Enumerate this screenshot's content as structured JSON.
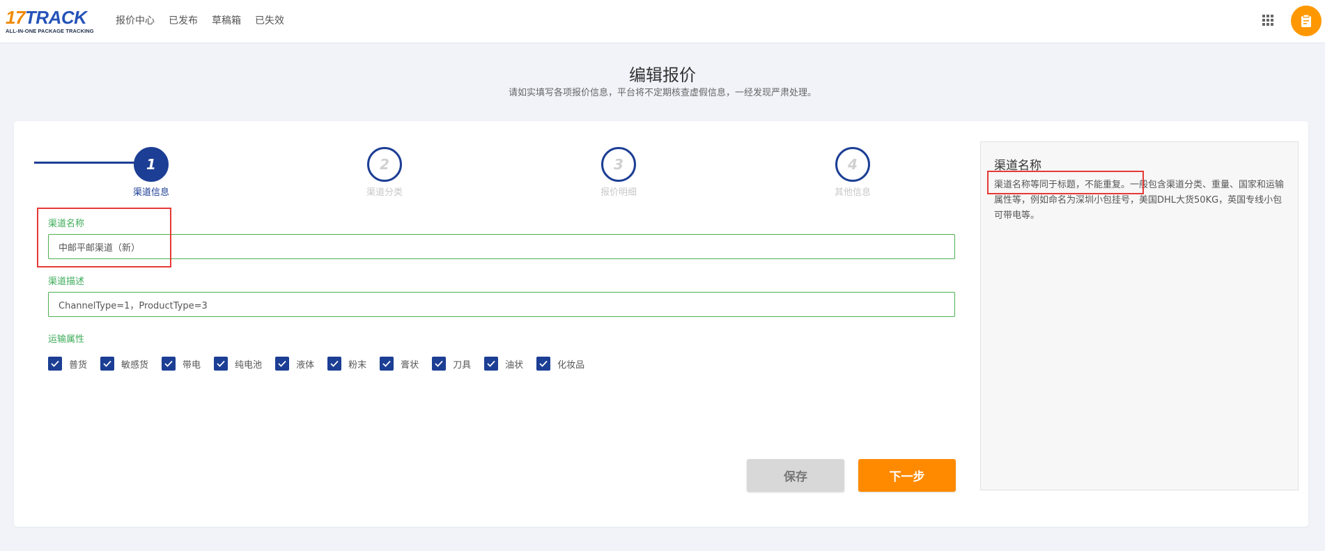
{
  "header": {
    "logo": {
      "main": "17TRACK",
      "sub": "ALL-IN-ONE PACKAGE TRACKING"
    },
    "nav": [
      "报价中心",
      "已发布",
      "草稿箱",
      "已失效"
    ],
    "apps_icon": "apps-grid-icon",
    "user_icon": "clipboard-icon"
  },
  "page": {
    "title": "编辑报价",
    "subtitle": "请如实填写各项报价信息，平台将不定期核查虚假信息，一经发现严肃处理。"
  },
  "steps": [
    {
      "number": "1",
      "label": "渠道信息",
      "active": true
    },
    {
      "number": "2",
      "label": "渠道分类",
      "active": false
    },
    {
      "number": "3",
      "label": "报价明细",
      "active": false
    },
    {
      "number": "4",
      "label": "其他信息",
      "active": false
    }
  ],
  "form": {
    "channel_name": {
      "label": "渠道名称",
      "value": "中邮平邮渠道（新）"
    },
    "channel_desc": {
      "label": "渠道描述",
      "value": "ChannelType=1，ProductType=3"
    },
    "shipping_attrs": {
      "label": "运输属性",
      "options": [
        {
          "label": "普货",
          "checked": true
        },
        {
          "label": "敏感货",
          "checked": true
        },
        {
          "label": "带电",
          "checked": true
        },
        {
          "label": "纯电池",
          "checked": true
        },
        {
          "label": "液体",
          "checked": true
        },
        {
          "label": "粉末",
          "checked": true
        },
        {
          "label": "膏状",
          "checked": true
        },
        {
          "label": "刀具",
          "checked": true
        },
        {
          "label": "油状",
          "checked": true
        },
        {
          "label": "化妆品",
          "checked": true
        }
      ]
    }
  },
  "buttons": {
    "save": "保存",
    "next": "下一步"
  },
  "help": {
    "title": "渠道名称",
    "text": "渠道名称等同于标题，不能重复。一般包含渠道分类、重量、国家和运输属性等，例如命名为深圳小包挂号，美国DHL大货50KG，英国专线小包可带电等。"
  },
  "colors": {
    "primary": "#1c3e94",
    "accent_orange": "#ff8a00",
    "field_green": "#4caf50",
    "highlight_red": "#e53935"
  }
}
